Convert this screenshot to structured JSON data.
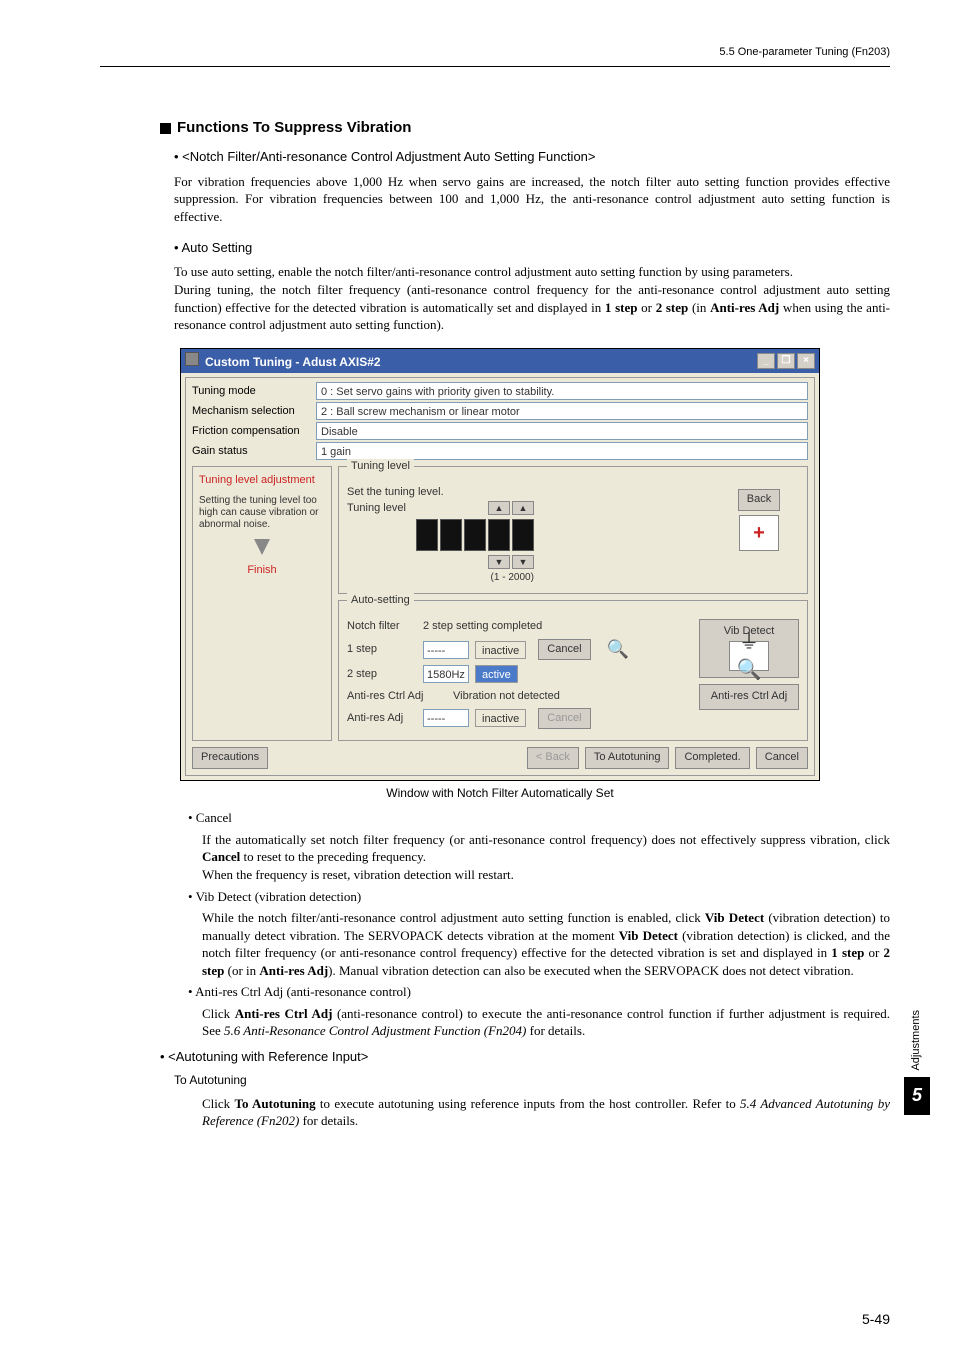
{
  "header": {
    "breadcrumb": "5.5  One-parameter Tuning (Fn203)"
  },
  "section": {
    "title": "Functions To Suppress Vibration",
    "notch": {
      "title": "• <Notch Filter/Anti-resonance Control Adjustment Auto Setting Function>",
      "body": "For vibration frequencies above 1,000 Hz when servo gains are increased, the notch filter auto setting function provides effective suppression. For vibration frequencies between 100 and 1,000 Hz, the anti-resonance control adjustment auto setting function is effective."
    },
    "auto": {
      "title": "• Auto Setting",
      "body1": "To use auto setting, enable the notch filter/anti-resonance control adjustment auto setting function by using parameters.",
      "body2a": "During tuning, the notch filter frequency (anti-resonance control frequency for the anti-resonance control adjustment auto setting function) effective for the detected vibration is automatically set and displayed in ",
      "body2b_1step": "1 step",
      "body2c": " or ",
      "body2d_2step": "2 step",
      "body2e": " (in ",
      "body2f_anti": "Anti-res Adj",
      "body2g": " when using the anti-resonance control adjustment auto setting function)."
    }
  },
  "win": {
    "title": "Custom Tuning - Adust AXIS#2",
    "min": "_",
    "max": "❐",
    "close": "×",
    "rows": {
      "tuning_mode_label": "Tuning mode",
      "tuning_mode_value": "0 : Set servo gains with priority given to stability.",
      "mech_label": "Mechanism selection",
      "mech_value": "2 : Ball screw mechanism or linear motor",
      "fric_label": "Friction compensation",
      "fric_value": "Disable",
      "gain_label": "Gain status",
      "gain_value": "1 gain"
    },
    "left": {
      "adjust_title": "Tuning level adjustment",
      "note": "Setting the tuning level too high can cause vibration or abnormal noise.",
      "finish": "Finish"
    },
    "tuning": {
      "legend": "Tuning level",
      "set_label": "Set the tuning level.",
      "level_label": "Tuning level",
      "up": "▲",
      "down": "▼",
      "range": "(1 - 2000)",
      "back": "Back",
      "plus": "+"
    },
    "autoset": {
      "legend": "Auto-setting",
      "notch_label": "Notch filter",
      "notch_value": "2 step setting completed",
      "step1_label": "1 step",
      "step1_hz": "-----",
      "step1_status": "inactive",
      "step2_label": "2 step",
      "step2_hz": "1580Hz",
      "step2_status": "active",
      "cancel": "Cancel",
      "mag": "🔍",
      "vib_detect": "Vib Detect",
      "vib_icon": "⏚🔍",
      "arc_label": "Anti-res Ctrl Adj",
      "arc_value": "Vibration not detected",
      "ares_label": "Anti-res Adj",
      "ares_hz": "-----",
      "ares_status": "inactive",
      "ares_cancel": "Cancel",
      "arc_btn": "Anti-res Ctrl Adj"
    },
    "footer": {
      "precautions": "Precautions",
      "back": "< Back",
      "to_auto": "To Autotuning",
      "completed": "Completed.",
      "cancel": "Cancel"
    }
  },
  "caption": "Window with Notch Filter Automatically Set",
  "cancel": {
    "title": "• Cancel",
    "b1a": "If the automatically set notch filter frequency (or anti-resonance control frequency) does not effectively suppress vibration, click ",
    "b1b": "Cancel",
    "b1c": " to reset to the preceding frequency.",
    "b2": "When the frequency is reset, vibration detection will restart."
  },
  "vib": {
    "title": "• Vib Detect (vibration detection)",
    "p_a": "While the notch filter/anti-resonance control adjustment auto setting function is enabled, click ",
    "p_b": "Vib Detect",
    "p_c": " (vibration detection) to manually detect vibration. The SERVOPACK detects vibration at the moment ",
    "p_d": "Vib Detect",
    "p_e": " (vibration detection) is clicked, and the notch filter frequency (or anti-resonance control frequency) effective for the detected vibration is set and displayed in ",
    "p_f": "1 step",
    "p_g": " or ",
    "p_h": "2 step",
    "p_i": " (or in ",
    "p_j": "Anti-res Adj",
    "p_k": "). Manual vibration detection can also be executed when the SERVOPACK does not detect vibration."
  },
  "arc": {
    "title": "• Anti-res Ctrl Adj (anti-resonance control)",
    "p_a": "Click ",
    "p_b": "Anti-res Ctrl Adj",
    "p_c": " (anti-resonance control) to execute the anti-resonance control function if further adjustment is required. See ",
    "p_d": "5.6  Anti-Resonance Control Adjustment Function (Fn204)",
    "p_e": " for details."
  },
  "autoref": {
    "title": "• <Autotuning with Reference Input>",
    "sub": "To Autotuning",
    "p_a": "Click ",
    "p_b": "To Autotuning",
    "p_c": " to execute autotuning using reference inputs from the host controller. Refer to ",
    "p_d": "5.4  Advanced Autotuning by Reference (Fn202)",
    "p_e": " for details."
  },
  "side": {
    "label": "Adjustments",
    "num": "5"
  },
  "pagenum": "5-49"
}
